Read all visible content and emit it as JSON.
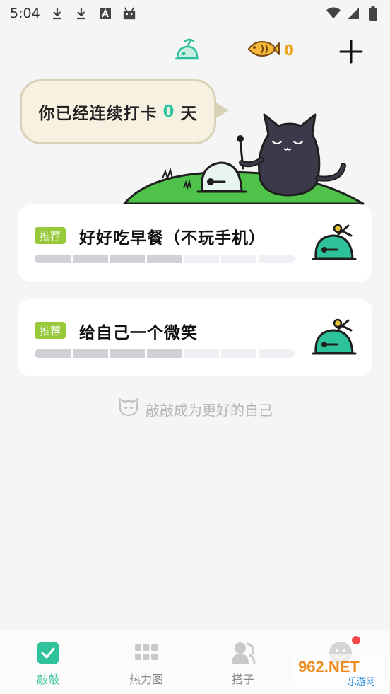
{
  "status_bar": {
    "time": "5:04",
    "icons": [
      "download-icon",
      "download-icon",
      "font-a-icon",
      "android-icon",
      "wifi-icon",
      "signal-icon",
      "battery-icon"
    ]
  },
  "top_bar": {
    "ufo_icon": "ufo-icon",
    "coin_icon": "fish-coin-icon",
    "coin_count": "0",
    "add_icon": "plus-icon"
  },
  "hero": {
    "streak_prefix": "你已经连续打卡",
    "streak_days": "0",
    "streak_suffix": "天"
  },
  "tasks": [
    {
      "tag": "推荐",
      "title": "好好吃早餐（不玩手机）",
      "progress_filled_segments": 4,
      "progress_total_segments": 7,
      "icon": "wooden-fish-icon"
    },
    {
      "tag": "推荐",
      "title": "给自己一个微笑",
      "progress_filled_segments": 4,
      "progress_total_segments": 7,
      "icon": "wooden-fish-icon"
    }
  ],
  "slogan": "敲敲成为更好的自己",
  "nav": [
    {
      "label": "敲敲",
      "icon": "check-icon",
      "active": true
    },
    {
      "label": "热力图",
      "icon": "grid-icon",
      "active": false
    },
    {
      "label": "搭子",
      "icon": "buddy-icon",
      "active": false
    },
    {
      "label": "",
      "icon": "profile-icon",
      "active": false,
      "badge": true
    }
  ],
  "colors": {
    "accent": "#2fc29b",
    "tag_green": "#97c93a",
    "coin": "#e8a318",
    "badge": "#f04848"
  },
  "watermark": {
    "brand": "962.NET",
    "subtitle": "乐游网"
  }
}
